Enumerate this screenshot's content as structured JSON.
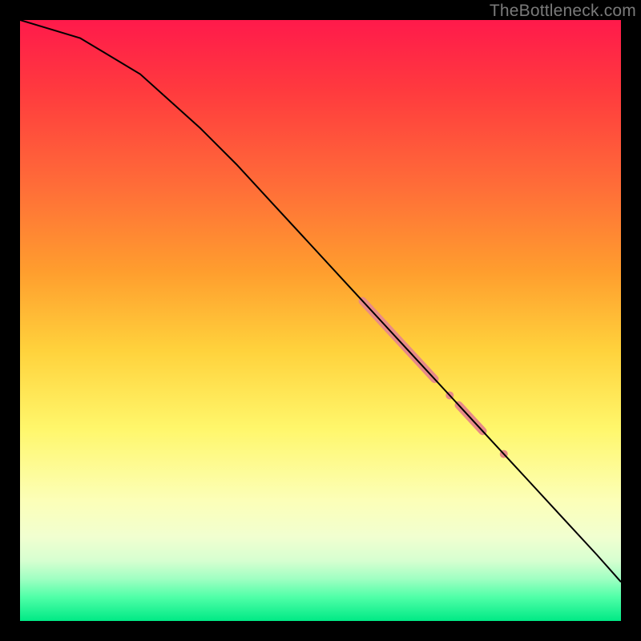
{
  "watermark": "TheBottleneck.com",
  "chart_data": {
    "type": "line",
    "title": "",
    "xlabel": "",
    "ylabel": "",
    "xlim": [
      0,
      100
    ],
    "ylim": [
      0,
      100
    ],
    "grid": false,
    "legend": false,
    "background_gradient": "red-to-green-vertical",
    "series": [
      {
        "name": "curve",
        "color": "#000000",
        "stroke_width": 2,
        "x": [
          0,
          10,
          20,
          30,
          36,
          42,
          48,
          54,
          60,
          66,
          72,
          78,
          84,
          90,
          96,
          100
        ],
        "y": [
          100,
          97,
          91,
          82,
          76,
          69.5,
          63,
          56.5,
          50,
          43.5,
          37,
          30.5,
          24,
          17.5,
          11,
          6.5
        ]
      }
    ],
    "highlights": [
      {
        "name": "segment-1",
        "x_start": 57,
        "x_end": 69,
        "color": "#e78a87",
        "width": 10
      },
      {
        "name": "dot-1",
        "x_center": 71.5,
        "color": "#e78a87",
        "radius": 5
      },
      {
        "name": "segment-2",
        "x_start": 73,
        "x_end": 77,
        "color": "#e78a87",
        "width": 10
      },
      {
        "name": "dot-2",
        "x_center": 80.5,
        "color": "#e78a87",
        "radius": 5
      }
    ]
  }
}
